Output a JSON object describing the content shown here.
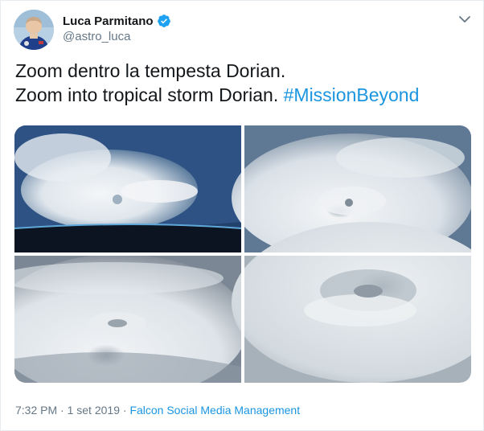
{
  "author": {
    "name": "Luca Parmitano",
    "handle": "@astro_luca",
    "verified": true,
    "avatar_icon": "astronaut-avatar"
  },
  "tweet": {
    "line1": "Zoom dentro la tempesta Dorian.",
    "line2_text": "Zoom into tropical storm Dorian. ",
    "hashtag": "#MissionBeyond"
  },
  "media": {
    "count": 4,
    "items": [
      "hurricane-photo-1",
      "hurricane-photo-2",
      "hurricane-photo-3",
      "hurricane-photo-4"
    ]
  },
  "meta": {
    "time": "7:32 PM",
    "separator": " · ",
    "date": "1 set 2019",
    "separator2": " · ",
    "source": "Falcon Social Media Management"
  },
  "colors": {
    "text": "#14171a",
    "secondary": "#657786",
    "link": "#1b95e0",
    "verified": "#1da1f2"
  }
}
